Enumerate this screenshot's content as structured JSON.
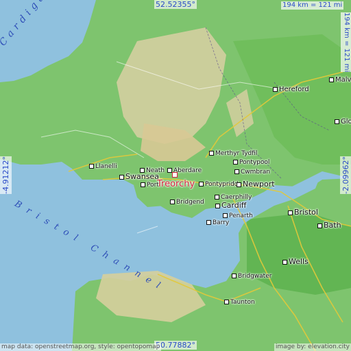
{
  "coords": {
    "top": "52.52355°",
    "bottom": "50.77882°",
    "left": "-4.91212°",
    "right": "-2.09962°"
  },
  "scale": {
    "horizontal": "194 km = 121 mi",
    "vertical": "194 km = 121 mi"
  },
  "highlight_city": "Treorchy",
  "sea_labels": {
    "cardigan": "Cardigan",
    "bristol_channel": "Bristol Channel"
  },
  "cities": [
    {
      "key": "hereford",
      "name": "Hereford"
    },
    {
      "key": "malvern",
      "name": "Malvern"
    },
    {
      "key": "glos",
      "name": "Glo"
    },
    {
      "key": "merthyr",
      "name": "Merthyr Tydfil"
    },
    {
      "key": "pontypool",
      "name": "Pontypool"
    },
    {
      "key": "cwmbran",
      "name": "Cwmbran"
    },
    {
      "key": "pontypridd",
      "name": "Pontypridd"
    },
    {
      "key": "newport",
      "name": "Newport"
    },
    {
      "key": "llanelli",
      "name": "Llanelli"
    },
    {
      "key": "neath",
      "name": "Neath"
    },
    {
      "key": "aberdare",
      "name": "Aberdare"
    },
    {
      "key": "swansea",
      "name": "Swansea"
    },
    {
      "key": "port",
      "name": "Port"
    },
    {
      "key": "bridgend",
      "name": "Bridgend"
    },
    {
      "key": "caerphilly",
      "name": "Caerphilly"
    },
    {
      "key": "cardiff",
      "name": "Cardiff"
    },
    {
      "key": "penarth",
      "name": "Penarth"
    },
    {
      "key": "barry",
      "name": "Barry"
    },
    {
      "key": "bristol",
      "name": "Bristol"
    },
    {
      "key": "bath",
      "name": "Bath"
    },
    {
      "key": "wells",
      "name": "Wells"
    },
    {
      "key": "bridgwater",
      "name": "Bridgwater"
    },
    {
      "key": "taunton",
      "name": "Taunton"
    }
  ],
  "footer": {
    "left": "map data: openstreetmap.org, style: opentopomap",
    "right": "image by: elevation.city"
  }
}
